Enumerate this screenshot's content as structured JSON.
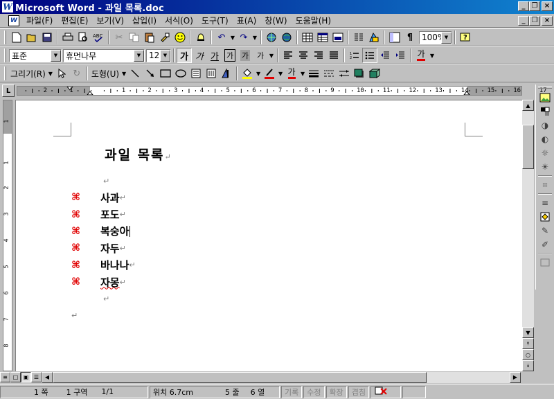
{
  "window": {
    "app_icon": "W",
    "title": "Microsoft Word - 과일 목록.doc",
    "min": "_",
    "restore": "❐",
    "close": "×"
  },
  "menu": {
    "items": [
      "파일(F)",
      "편집(E)",
      "보기(V)",
      "삽입(I)",
      "서식(O)",
      "도구(T)",
      "표(A)",
      "창(W)",
      "도움말(H)"
    ]
  },
  "toolbar_standard": {
    "icons": [
      "new-document-icon",
      "open-folder-icon",
      "save-icon",
      "print-icon",
      "print-preview-icon",
      "spell-check-icon",
      "cut-icon",
      "copy-icon",
      "paste-icon",
      "format-painter-icon",
      "smiley-icon",
      "bell-icon",
      "undo-icon",
      "redo-icon",
      "web-icon",
      "globe-icon",
      "insert-table-icon",
      "insert-excel-icon",
      "columns-icon",
      "drawing-icon",
      "doc-map-icon",
      "show-hide-icon",
      "help-icon"
    ],
    "zoom": "100%"
  },
  "toolbar_format": {
    "style": "표준",
    "font": "휴먼나무",
    "size": "12",
    "bold_label": "가",
    "italic_label": "가",
    "underline_label": "가",
    "border_label": "가",
    "shade_label": "가",
    "phonetic_label": "가",
    "font_color_label": "가"
  },
  "toolbar_drawing": {
    "draw_menu": "그리기(R)",
    "autoshape_menu": "도형(U)",
    "font_color_label": "가"
  },
  "ruler": {
    "h_numbers": [
      "2",
      "1",
      "",
      "1",
      "2",
      "3",
      "4",
      "5",
      "6",
      "7",
      "8",
      "9",
      "10",
      "11",
      "12",
      "13",
      "14",
      "15",
      "16",
      "17"
    ],
    "v_numbers": [
      "1",
      "1",
      "2",
      "3",
      "4",
      "5",
      "6",
      "7",
      "8"
    ]
  },
  "document": {
    "heading": "과일 목록",
    "para_mark": "↵",
    "bullet": "⌘",
    "items": [
      {
        "text": "사과"
      },
      {
        "text": "포도"
      },
      {
        "text": "복숭아"
      },
      {
        "text": "자두"
      },
      {
        "text": "바나나"
      },
      {
        "text": "자몽"
      }
    ]
  },
  "statusbar": {
    "page": "1 쪽",
    "section": "1 구역",
    "page_of": "1/1",
    "position": "위치 6.7cm",
    "line": "5 줄",
    "column": "6 열",
    "rec": "기록",
    "trk": "수정",
    "ext": "확장",
    "ovr": "겹침"
  },
  "colors": {
    "title_start": "#000080",
    "title_end": "#1084d0",
    "bullet": "#e00000",
    "chrome": "#c0c0c0"
  }
}
